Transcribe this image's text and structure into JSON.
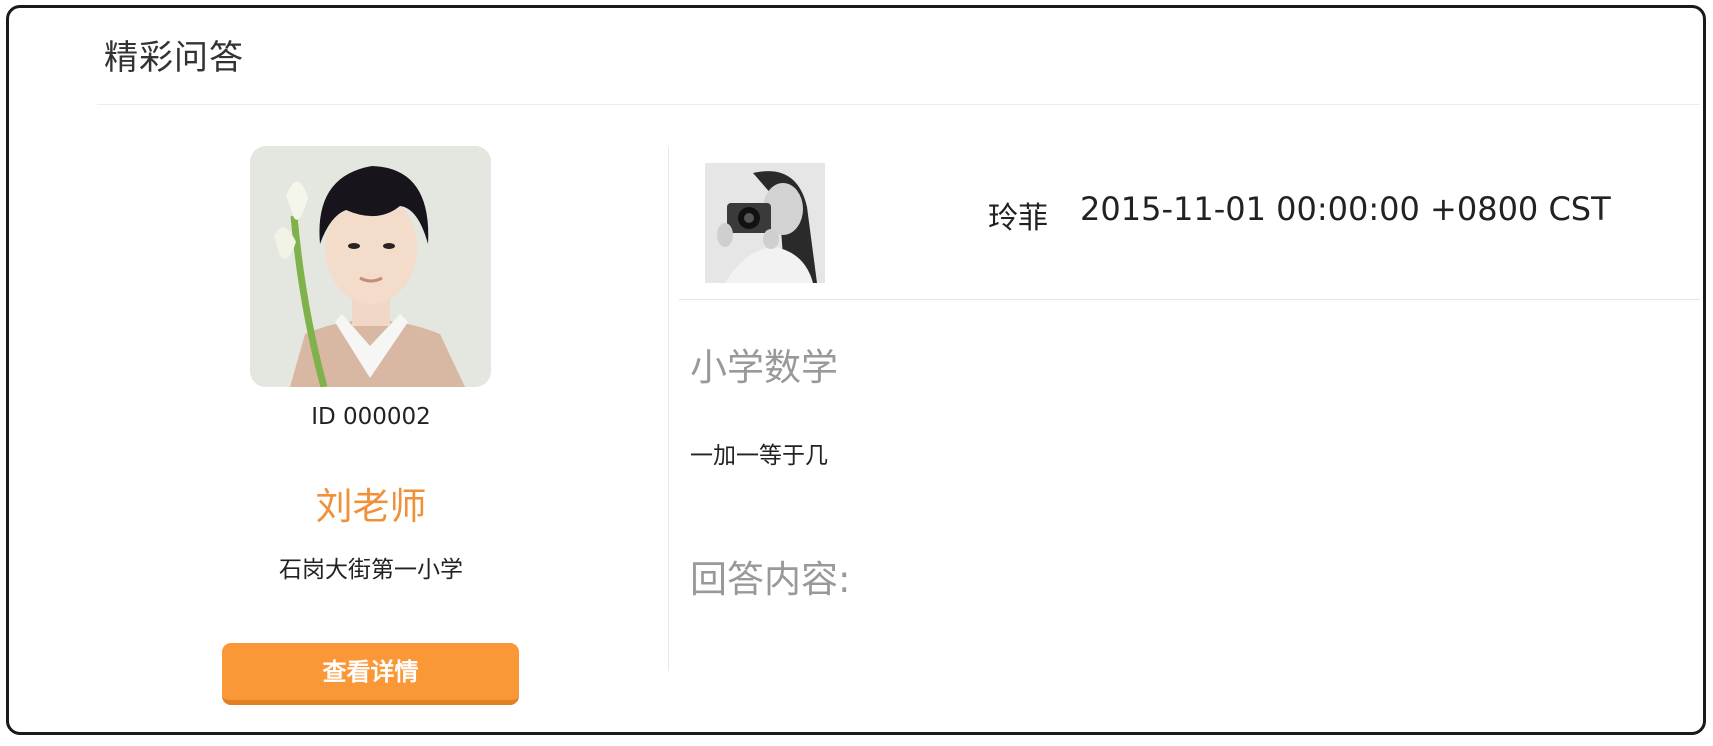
{
  "header": {
    "title": "精彩问答"
  },
  "teacher": {
    "avatar_icon": "teacher-portrait",
    "id_text": "ID 000002",
    "name": "刘老师",
    "school": "石岗大街第一小学",
    "details_label": "查看详情"
  },
  "question": {
    "asker_avatar_icon": "asker-portrait",
    "asker_name": "玲菲",
    "time": "2015-11-01 00:00:00 +0800 CST",
    "subject": "小学数学",
    "text": "一加一等于几",
    "answer_label": "回答内容:"
  },
  "colors": {
    "accent": "#fa9838",
    "teacher_name": "#f0913a",
    "muted_heading": "#999999"
  }
}
